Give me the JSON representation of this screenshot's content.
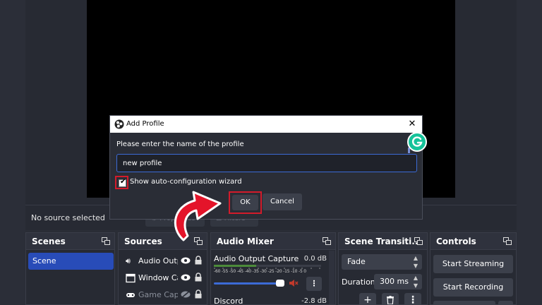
{
  "source_bar": {
    "no_source": "No source selected",
    "properties_label": "Properties",
    "filters_label": "Filters"
  },
  "docks": {
    "scenes": {
      "title": "Scenes",
      "items": [
        "Scene"
      ]
    },
    "sources": {
      "title": "Sources",
      "items": [
        {
          "label": "Audio Output Capture",
          "icon": "speaker-icon",
          "hidden": false
        },
        {
          "label": "Window Capture",
          "icon": "window-icon",
          "hidden": false
        },
        {
          "label": "Game Capture",
          "icon": "gamepad-icon",
          "hidden": true
        }
      ]
    },
    "mixer": {
      "title": "Audio Mixer",
      "channels": [
        {
          "name": "Audio Output Capture",
          "db": "0.0 dB"
        },
        {
          "name": "Discord",
          "db": "-2.8 dB"
        }
      ],
      "meter_scale": "-60 -55 -50 -45 -40 -35 -30 -25 -20 -15 -10 -5 0"
    },
    "transitions": {
      "title": "Scene Transiti...",
      "selected": "Fade",
      "duration_label": "Duration",
      "duration_value": "300 ms"
    },
    "controls": {
      "title": "Controls",
      "start_streaming": "Start Streaming",
      "start_recording": "Start Recording"
    }
  },
  "dialog": {
    "title": "Add Profile",
    "prompt": "Please enter the name of the profile",
    "input_value": "new profile",
    "checkbox_label": "Show auto-configuration wizard",
    "checkbox_checked": true,
    "ok_label": "OK",
    "cancel_label": "Cancel"
  },
  "colors": {
    "accent": "#284cb8",
    "highlight": "#d31b2b",
    "grammarly": "#15c39a"
  }
}
